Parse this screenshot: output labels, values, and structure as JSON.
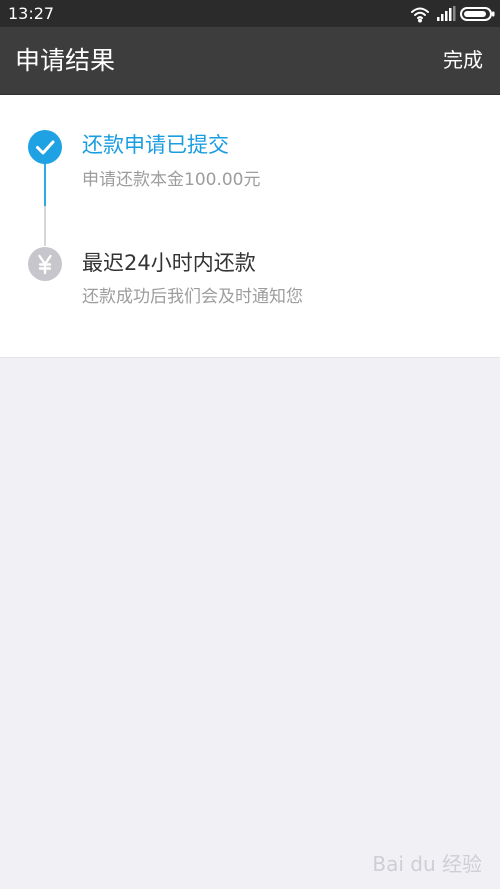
{
  "status_bar": {
    "time": "13:27",
    "icons": [
      "wifi-icon",
      "signal-icon",
      "battery-icon"
    ]
  },
  "app_bar": {
    "title": "申请结果",
    "done_label": "完成"
  },
  "steps": [
    {
      "title": "还款申请已提交",
      "subtitle": "申请还款本金100.00元",
      "icon": "check-icon",
      "state": "completed",
      "color": "#1ea2e4"
    },
    {
      "title": "最迟24小时内还款",
      "subtitle": "还款成功后我们会及时通知您",
      "icon": "yen-icon",
      "state": "pending",
      "color": "#c6c6cc"
    }
  ],
  "watermark": "Bai du 经验",
  "colors": {
    "status_bar": "#2b2b2b",
    "app_bar": "#3d3d3d",
    "accent": "#1ea2e4",
    "page_background": "#f1f0f5"
  }
}
